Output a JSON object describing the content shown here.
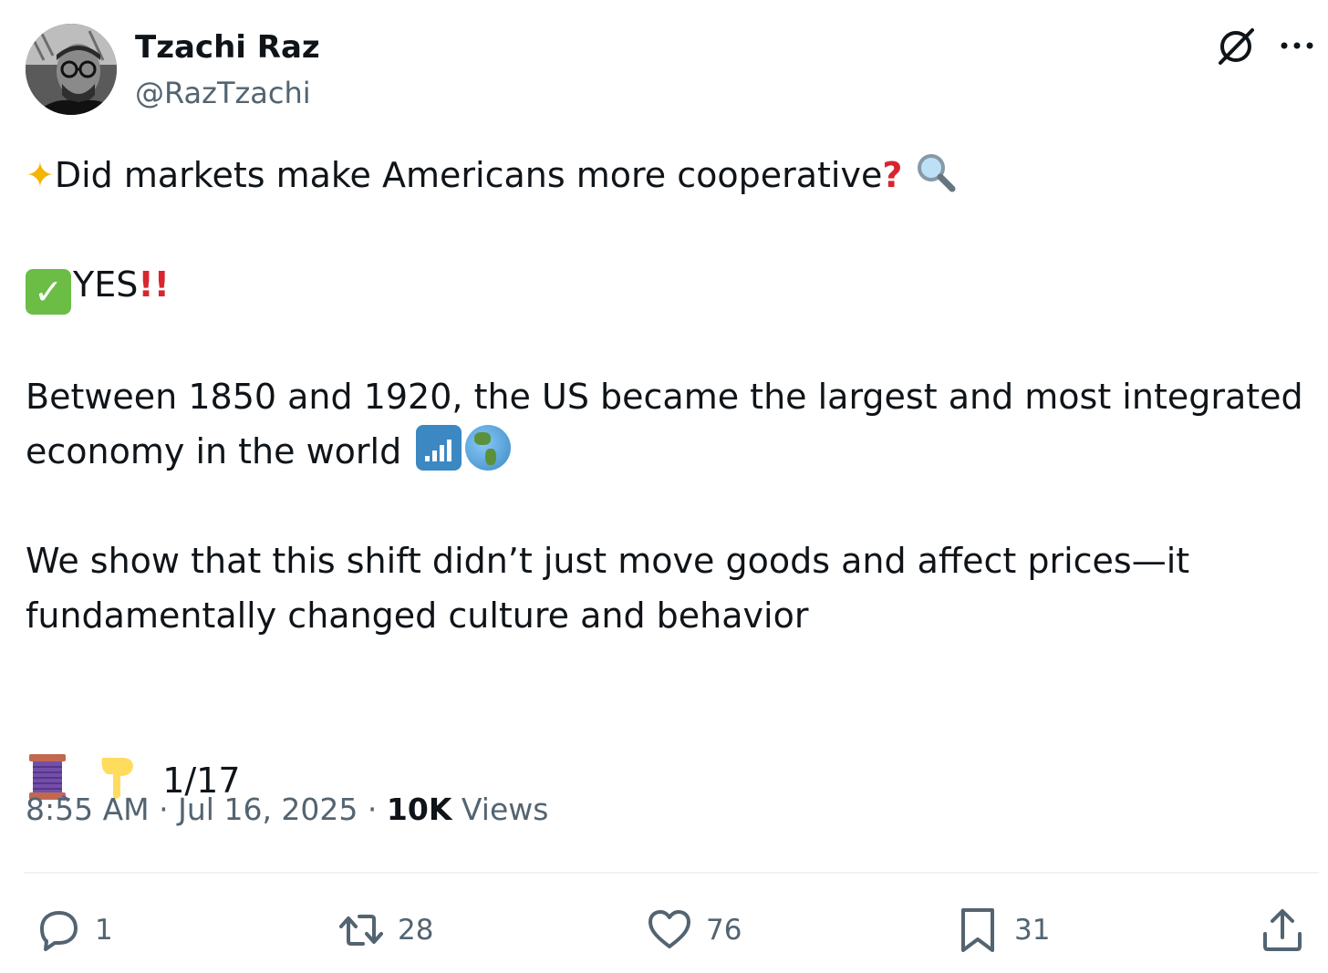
{
  "author": {
    "name": "Tzachi Raz",
    "handle": "@RazTzachi"
  },
  "tweet": {
    "line1": "Did markets make Americans more cooperative",
    "line2": "YES",
    "line3": "Between 1850 and 1920, the US became the largest and most integrated economy in the world",
    "line4": "We show that this shift didn’t just move goods and affect prices—it fundamentally changed culture and behavior",
    "thread_counter": "1/17"
  },
  "meta": {
    "time": "8:55 AM",
    "separator1": "·",
    "date": "Jul 16, 2025",
    "separator2": "·",
    "views_count": "10K",
    "views_label": "Views"
  },
  "actions": {
    "replies": "1",
    "reposts": "28",
    "likes": "76",
    "bookmarks": "31"
  },
  "icons": {
    "more": "more-icon",
    "grok": "grok-icon",
    "reply": "reply-icon",
    "repost": "repost-icon",
    "like": "heart-icon",
    "bookmark": "bookmark-icon",
    "share": "share-icon"
  },
  "colors": {
    "text_primary": "#0f1419",
    "text_secondary": "#536471",
    "divider": "#eff3f4"
  }
}
